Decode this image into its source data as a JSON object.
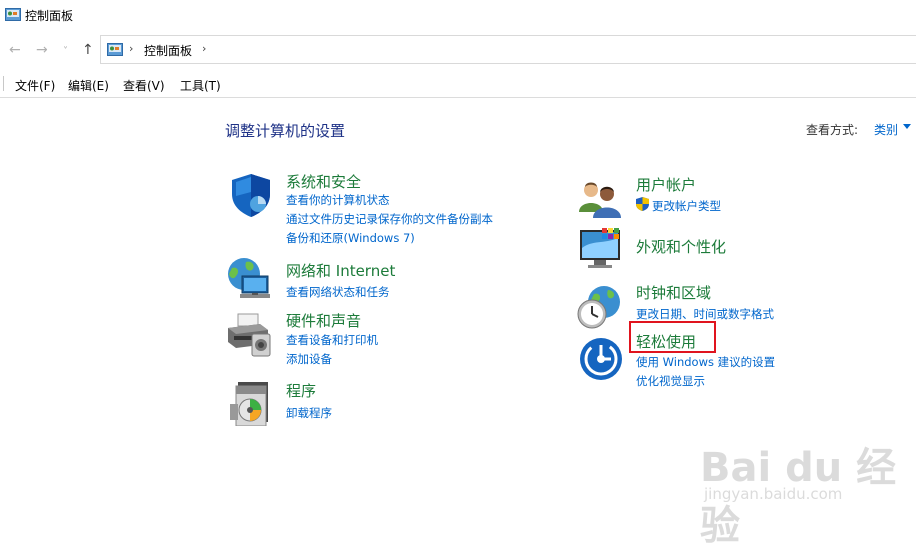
{
  "window": {
    "title": "控制面板"
  },
  "nav": {
    "back": "←",
    "forward": "→",
    "recent": "˅",
    "up": "↑",
    "address_sep": "›",
    "address_text": "控制面板"
  },
  "menu": [
    "文件(F)",
    "编辑(E)",
    "查看(V)",
    "工具(T)"
  ],
  "main": {
    "heading": "调整计算机的设置",
    "view_by_label": "查看方式:",
    "view_by_value": "类别"
  },
  "categories_left": [
    {
      "title": "系统和安全",
      "icon": "shield-icon",
      "links": [
        "查看你的计算机状态",
        "通过文件历史记录保存你的文件备份副本",
        "备份和还原(Windows 7)"
      ]
    },
    {
      "title": "网络和 Internet",
      "icon": "network-icon",
      "links": [
        "查看网络状态和任务"
      ]
    },
    {
      "title": "硬件和声音",
      "icon": "printer-icon",
      "links": [
        "查看设备和打印机",
        "添加设备"
      ]
    },
    {
      "title": "程序",
      "icon": "programs-icon",
      "links": [
        "卸载程序"
      ]
    }
  ],
  "categories_right": [
    {
      "title": "用户帐户",
      "icon": "users-icon",
      "links": [
        "更改帐户类型"
      ]
    },
    {
      "title": "外观和个性化",
      "icon": "monitor-icon",
      "links": []
    },
    {
      "title": "时钟和区域",
      "icon": "clock-globe-icon",
      "links": [
        "更改日期、时间或数字格式"
      ]
    },
    {
      "title": "轻松使用",
      "icon": "ease-of-access-icon",
      "links": [
        "使用 Windows 建议的设置",
        "优化视觉显示"
      ]
    }
  ],
  "watermark": {
    "main": "Bai du 经验",
    "sub": "jingyan.baidu.com"
  },
  "colors": {
    "link": "#0066cc",
    "category": "#1c7b3a",
    "heading": "#1e3287",
    "highlight": "#e0141e"
  }
}
